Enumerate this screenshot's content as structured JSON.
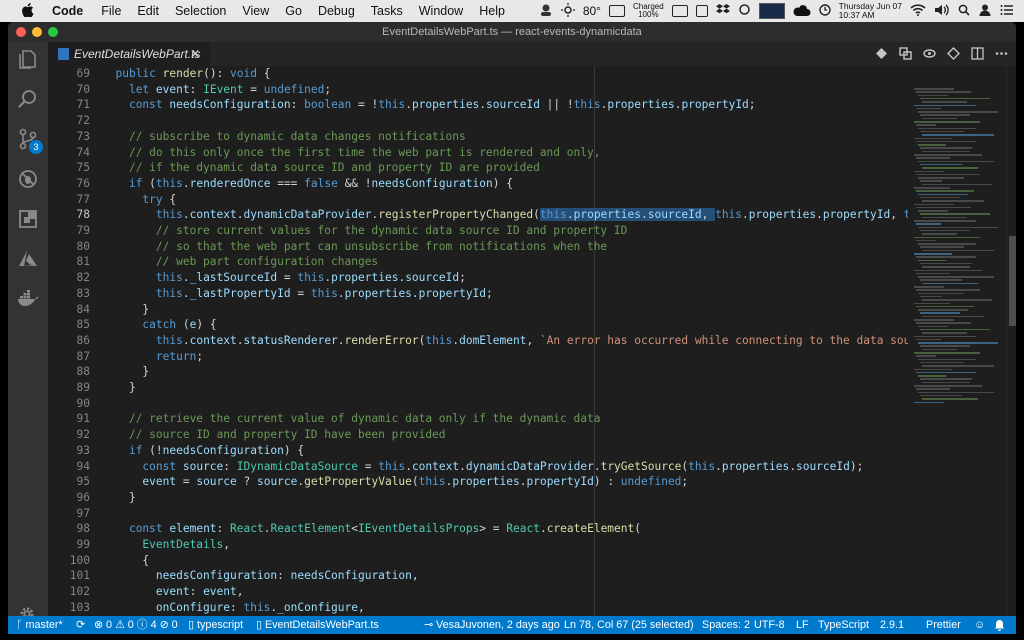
{
  "menubar": {
    "app": "Code",
    "items": [
      "File",
      "Edit",
      "Selection",
      "View",
      "Go",
      "Debug",
      "Tasks",
      "Window",
      "Help"
    ],
    "temperature": "80°",
    "battery_line1": "Charged",
    "battery_line2": "100%",
    "date": "Thursday Jun 07",
    "time": "10:37 AM"
  },
  "window": {
    "title": "EventDetailsWebPart.ts — react-events-dynamicdata",
    "tab_label": "EventDetailsWebPart.ts"
  },
  "activity": {
    "scm_badge": "3"
  },
  "editor": {
    "current_line": "78",
    "lines": [
      {
        "n": "69",
        "code": "  public render(): void {"
      },
      {
        "n": "70",
        "code": "    let event: IEvent = undefined;"
      },
      {
        "n": "71",
        "code": "    const needsConfiguration: boolean = !this.properties.sourceId || !this.properties.propertyId;"
      },
      {
        "n": "72",
        "code": ""
      },
      {
        "n": "73",
        "code": "    // subscribe to dynamic data changes notifications"
      },
      {
        "n": "74",
        "code": "    // do this only once the first time the web part is rendered and only,"
      },
      {
        "n": "75",
        "code": "    // if the dynamic data source ID and property ID are provided"
      },
      {
        "n": "76",
        "code": "    if (this.renderedOnce === false && !needsConfiguration) {"
      },
      {
        "n": "77",
        "code": "      try {"
      },
      {
        "n": "78",
        "code": "        this.context.dynamicDataProvider.registerPropertyChanged(this.properties.sourceId, this.properties.propertyId, this.render)"
      },
      {
        "n": "79",
        "code": "        // store current values for the dynamic data source ID and property ID"
      },
      {
        "n": "80",
        "code": "        // so that the web part can unsubscribe from notifications when the"
      },
      {
        "n": "81",
        "code": "        // web part configuration changes"
      },
      {
        "n": "82",
        "code": "        this._lastSourceId = this.properties.sourceId;"
      },
      {
        "n": "83",
        "code": "        this._lastPropertyId = this.properties.propertyId;"
      },
      {
        "n": "84",
        "code": "      }"
      },
      {
        "n": "85",
        "code": "      catch (e) {"
      },
      {
        "n": "86",
        "code": "        this.context.statusRenderer.renderError(this.domElement, `An error has occurred while connecting to the data source. Detail"
      },
      {
        "n": "87",
        "code": "        return;"
      },
      {
        "n": "88",
        "code": "      }"
      },
      {
        "n": "89",
        "code": "    }"
      },
      {
        "n": "90",
        "code": ""
      },
      {
        "n": "91",
        "code": "    // retrieve the current value of dynamic data only if the dynamic data"
      },
      {
        "n": "92",
        "code": "    // source ID and property ID have been provided"
      },
      {
        "n": "93",
        "code": "    if (!needsConfiguration) {"
      },
      {
        "n": "94",
        "code": "      const source: IDynamicDataSource = this.context.dynamicDataProvider.tryGetSource(this.properties.sourceId);"
      },
      {
        "n": "95",
        "code": "      event = source ? source.getPropertyValue(this.properties.propertyId) : undefined;"
      },
      {
        "n": "96",
        "code": "    }"
      },
      {
        "n": "97",
        "code": ""
      },
      {
        "n": "98",
        "code": "    const element: React.ReactElement<IEventDetailsProps> = React.createElement("
      },
      {
        "n": "99",
        "code": "      EventDetails,"
      },
      {
        "n": "100",
        "code": "      {"
      },
      {
        "n": "101",
        "code": "        needsConfiguration: needsConfiguration,"
      },
      {
        "n": "102",
        "code": "        event: event,"
      },
      {
        "n": "103",
        "code": "        onConfigure: this._onConfigure,"
      }
    ]
  },
  "statusbar": {
    "branch": "master*",
    "errors": "0",
    "warnings": "0",
    "infos": "4",
    "other": "0",
    "language_service": "typescript",
    "file": "EventDetailsWebPart.ts",
    "blame": "VesaJuvonen, 2 days ago",
    "position": "Ln 78, Col 67 (25 selected)",
    "spaces": "Spaces: 2",
    "encoding": "UTF-8",
    "eol": "LF",
    "language": "TypeScript",
    "version": "2.9.1",
    "formatter": "Prettier"
  },
  "colors": {
    "accent": "#007acc",
    "selection": "#264f78",
    "keyword": "#569cd6",
    "comment": "#6a9955"
  }
}
